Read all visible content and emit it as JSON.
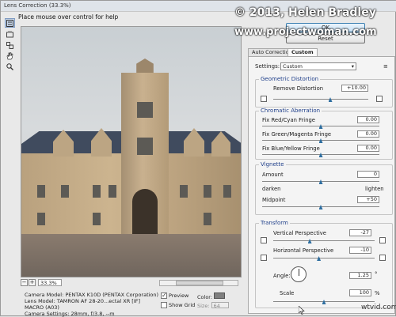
{
  "window": {
    "title": "Lens Correction (33.3%)"
  },
  "hint": "Place mouse over control for help",
  "buttons": {
    "ok": "OK",
    "reset": "Reset"
  },
  "tabs": [
    {
      "label": "Auto Correction"
    },
    {
      "label": "Custom"
    }
  ],
  "settings": {
    "label": "Settings:",
    "value": "Custom"
  },
  "geometric": {
    "legend": "Geometric Distortion",
    "remove_distortion": {
      "label": "Remove Distortion",
      "value": "+10.00",
      "level": 0.6
    }
  },
  "chromatic": {
    "legend": "Chromatic Aberration",
    "rows": [
      {
        "label": "Fix Red/Cyan Fringe",
        "value": "0.00",
        "level": 0.5
      },
      {
        "label": "Fix Green/Magenta Fringe",
        "value": "0.00",
        "level": 0.5
      },
      {
        "label": "Fix Blue/Yellow Fringe",
        "value": "0.00",
        "level": 0.5
      }
    ]
  },
  "vignette": {
    "legend": "Vignette",
    "amount": {
      "label": "Amount",
      "value": "0",
      "level": 0.5
    },
    "darken": "darken",
    "lighten": "lighten",
    "midpoint": {
      "label": "Midpoint",
      "value": "+50",
      "level": 0.5
    }
  },
  "transform": {
    "legend": "Transform",
    "vertical": {
      "label": "Vertical Perspective",
      "value": "-27",
      "level": 0.36
    },
    "horizontal": {
      "label": "Horizontal Perspective",
      "value": "-10",
      "level": 0.45
    },
    "angle": {
      "label": "Angle:",
      "value": "1.25",
      "unit": "°"
    },
    "scale": {
      "label": "Scale",
      "value": "100",
      "unit": "%",
      "level": 0.5
    }
  },
  "zoom": {
    "minus": "−",
    "plus": "+",
    "value": "33.3%"
  },
  "camera": {
    "model": "Camera Model: PENTAX K10D (PENTAX Corporation)",
    "lens": "Lens Model: TAMRON AF 28-20...ectal XR [IF] MACRO (A03)",
    "settings": "Camera Settings: 28mm, f/3.8, --m"
  },
  "options": {
    "preview": {
      "label": "Preview",
      "checked": true
    },
    "show_grid": {
      "label": "Show Grid",
      "checked": false
    },
    "color_label": "Color:",
    "size_label": "Size:",
    "size_value": "64"
  },
  "watermarks": {
    "copyright": "© 2013, Helen Bradley",
    "site": "www.projectwoman.com",
    "corner": "wtvid.com"
  }
}
